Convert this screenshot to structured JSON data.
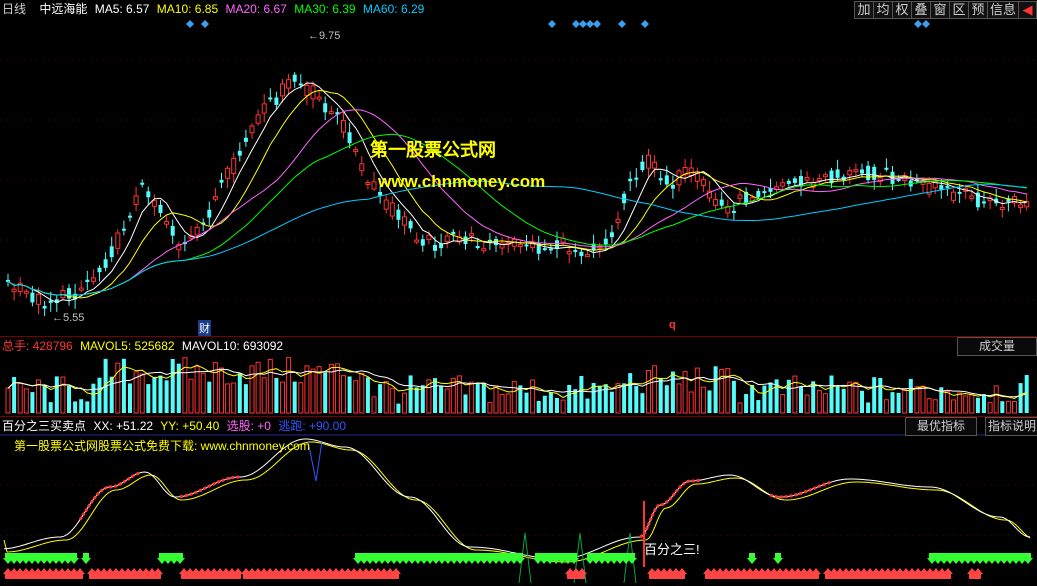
{
  "main": {
    "period": "日线",
    "stock": "中远海能",
    "ma": [
      {
        "label": "MA5: 6.57",
        "color": "#ffffff"
      },
      {
        "label": "MA10: 6.85",
        "color": "#ffff00"
      },
      {
        "label": "MA20: 6.67",
        "color": "#ff66ff"
      },
      {
        "label": "MA30: 6.39",
        "color": "#00ff00"
      },
      {
        "label": "MA60: 6.29",
        "color": "#00ccff"
      }
    ],
    "high_label": "9.75",
    "low_label": "5.55",
    "cai_label": "财",
    "q_label": "q",
    "watermark_title": "第一股票公式网",
    "watermark_url": "www.chnmoney.com"
  },
  "toolbar": [
    "加",
    "均",
    "权",
    "叠",
    "窗",
    "区",
    "预",
    "信息",
    "◀"
  ],
  "volume": {
    "total_label": "总手: 428796",
    "mavol5": "MAVOL5: 525682",
    "mavol10": "MAVOL10: 693092",
    "button": "成交量"
  },
  "indicator": {
    "name": "百分之三买卖点",
    "xx": "XX: +51.22",
    "yy": "YY: +50.40",
    "xuan_gu": "选股: +0",
    "tao_pao": "逃跑: +90.00",
    "btn_best": "最优指标",
    "btn_help": "指标说明",
    "promo": "第一股票公式网股票公式免费下载: www.chnmoney.com",
    "signal_text": "百分之三!"
  },
  "colors": {
    "up": "#ff3333",
    "down": "#54fcfc",
    "bg": "#000000",
    "divider": "#7a0000"
  }
}
